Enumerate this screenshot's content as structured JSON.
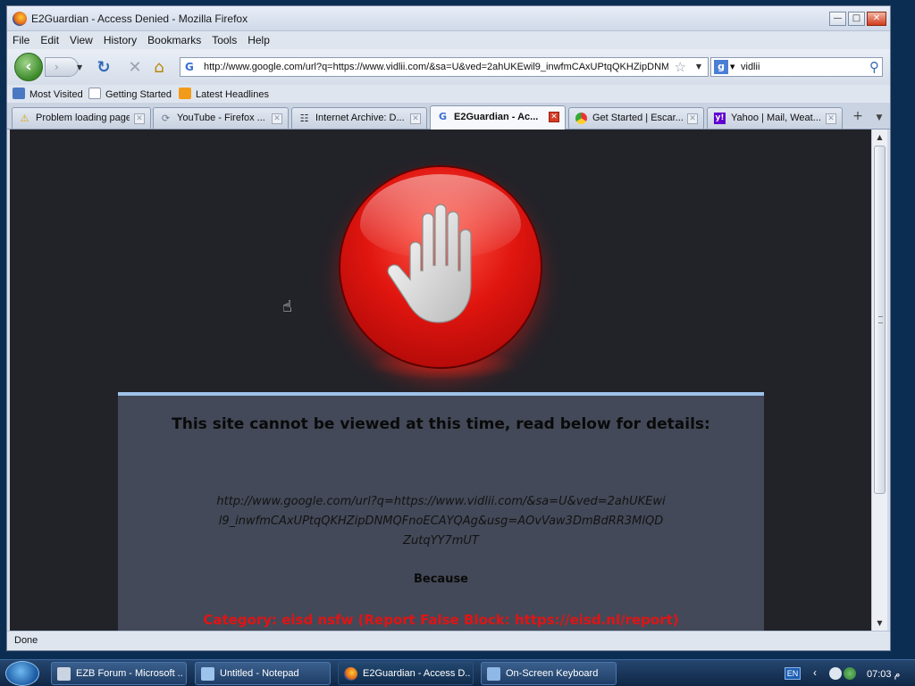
{
  "window": {
    "title": "E2Guardian - Access Denied - Mozilla Firefox"
  },
  "menu": [
    "File",
    "Edit",
    "View",
    "History",
    "Bookmarks",
    "Tools",
    "Help"
  ],
  "nav": {
    "url": "http://www.google.com/url?q=https://www.vidlii.com/&sa=U&ved=2ahUKEwil9_inwfmCAxUPtqQKHZipDNM",
    "search_query": "vidlii"
  },
  "bookmarks": [
    "Most Visited",
    "Getting Started",
    "Latest Headlines"
  ],
  "tabs": [
    {
      "label": "Problem loading page",
      "icon": "warning-icon"
    },
    {
      "label": "YouTube - Firefox ...",
      "icon": "loading-icon"
    },
    {
      "label": "Internet Archive: D...",
      "icon": "archive-icon"
    },
    {
      "label": "E2Guardian - Ac...",
      "icon": "google-icon"
    },
    {
      "label": "Get Started | Escar...",
      "icon": "chrome-icon"
    },
    {
      "label": "Yahoo | Mail, Weat...",
      "icon": "yahoo-icon"
    }
  ],
  "page": {
    "heading": "This site cannot be viewed at this time, read below for details:",
    "blocked_url": "http://www.google.com/url?q=https://www.vidlii.com/&sa=U&ved=2ahUKEwil9_inwfmCAxUPtqQKHZipDNMQFnoECAYQAg&usg=AOvVaw3DmBdRR3MlQDZutqYY7mUT",
    "because": "Because",
    "category": "Category: eisd nsfw (Report False Block: https://eisd.nl/report)"
  },
  "status": {
    "text": "Done"
  },
  "taskbar": {
    "tasks": [
      "EZB Forum - Microsoft ...",
      "Untitled - Notepad",
      "E2Guardian - Access D...",
      "On-Screen Keyboard"
    ],
    "lang": "EN",
    "clock": "07:03 م"
  },
  "colors": {
    "page_bg": "#222329",
    "panel_bg": "#434958",
    "panel_border": "#9ec3ea",
    "category_red": "#e01414",
    "stop_red": "#e0150f"
  }
}
